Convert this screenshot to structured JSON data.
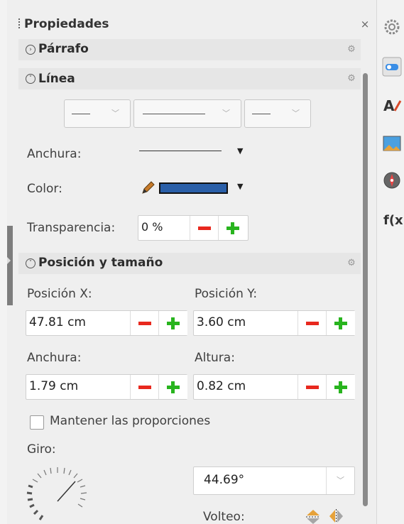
{
  "panel": {
    "title": "Propiedades",
    "close_glyph": "×"
  },
  "sections": {
    "parrafo": {
      "title": "Párrafo"
    },
    "linea": {
      "title": "Línea",
      "width_label": "Anchura:",
      "color_label": "Color:",
      "color_value": "#2a5fa8",
      "transparency_label": "Transparencia:",
      "transparency_value": "0 %"
    },
    "posicion": {
      "title": "Posición y tamaño",
      "pos_x_label": "Posición X:",
      "pos_x_value": "47.81 cm",
      "pos_y_label": "Posición Y:",
      "pos_y_value": "3.60 cm",
      "width_label": "Anchura:",
      "width_value": "1.79 cm",
      "height_label": "Altura:",
      "height_value": "0.82 cm",
      "keep_ratio_label": "Mantener las proporciones",
      "keep_ratio_checked": false,
      "rotation_label": "Giro:",
      "rotation_value": "44.69°",
      "flip_label": "Volteo:"
    }
  },
  "sidebar_icons": [
    "gear-icon",
    "properties-icon",
    "styles-icon",
    "gallery-icon",
    "navigator-icon",
    "functions-icon"
  ],
  "sidebar_text": {
    "functions": "f(x)"
  },
  "colors": {
    "minus": "#e8281e",
    "plus": "#28b41e",
    "line_color": "#2a5fa8"
  }
}
